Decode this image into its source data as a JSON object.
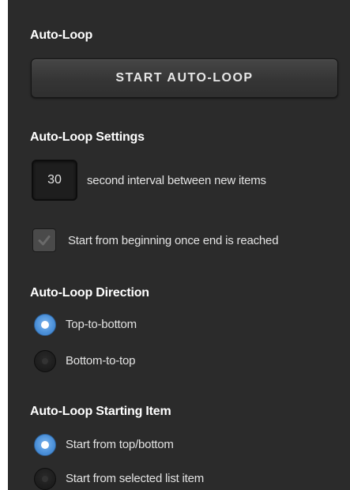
{
  "auto_loop": {
    "heading": "Auto-Loop",
    "start_button_label": "START AUTO-LOOP"
  },
  "settings": {
    "heading": "Auto-Loop Settings",
    "interval_value": "30",
    "interval_label": "second interval between new items",
    "restart_checkbox_label": "Start from beginning once end is reached",
    "restart_checked": true
  },
  "direction": {
    "heading": "Auto-Loop Direction",
    "options": [
      {
        "label": "Top-to-bottom",
        "selected": true
      },
      {
        "label": "Bottom-to-top",
        "selected": false
      }
    ]
  },
  "starting_item": {
    "heading": "Auto-Loop Starting Item",
    "options": [
      {
        "label": "Start from top/bottom",
        "selected": true
      },
      {
        "label": "Start from selected list item",
        "selected": false
      }
    ]
  },
  "colors": {
    "panel_background": "#2b2b2b",
    "radio_selected": "#4a8fd8",
    "text": "#e3e3e3"
  }
}
